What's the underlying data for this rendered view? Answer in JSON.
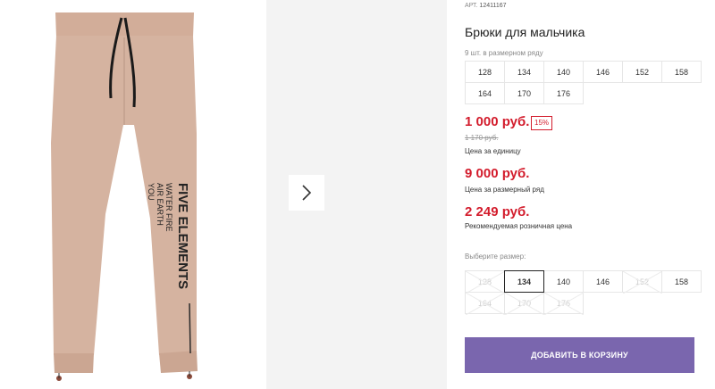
{
  "product": {
    "article_prefix": "АРТ.",
    "article_number": "12411167",
    "title": "Брюки для мальчика",
    "print_brand": "FIVE ELEMENTS",
    "print_line": "WATER FIRE",
    "print_line2": "AIR EARTH",
    "print_line3": "YOU"
  },
  "pack": {
    "note": "9 шт. в размерном ряду",
    "sizes": [
      "128",
      "134",
      "140",
      "146",
      "152",
      "158",
      "164",
      "170",
      "176"
    ]
  },
  "pricing": {
    "price": "1 000 руб.",
    "discount_badge": "15%",
    "old_price": "1 170 руб.",
    "unit_label": "Цена за единицу",
    "pack_price": "9 000 руб.",
    "pack_label": "Цена за размерный ряд",
    "rrp": "2 249 руб.",
    "rrp_label": "Рекомендуемая розничная цена"
  },
  "size_select": {
    "label": "Выберите размер:",
    "selected": "134",
    "options": [
      {
        "label": "128",
        "available": false
      },
      {
        "label": "134",
        "available": true
      },
      {
        "label": "140",
        "available": true
      },
      {
        "label": "146",
        "available": true
      },
      {
        "label": "152",
        "available": false
      },
      {
        "label": "158",
        "available": true
      },
      {
        "label": "164",
        "available": false
      },
      {
        "label": "170",
        "available": false
      },
      {
        "label": "176",
        "available": false
      }
    ]
  },
  "cart": {
    "add_label": "ДОБАВИТЬ В КОРЗИНУ"
  },
  "colors": {
    "accent": "#7a66ae",
    "price_red": "#d31c2c",
    "fabric": "#d5b3a0"
  },
  "icons": {
    "next": "chevron-right-icon"
  }
}
